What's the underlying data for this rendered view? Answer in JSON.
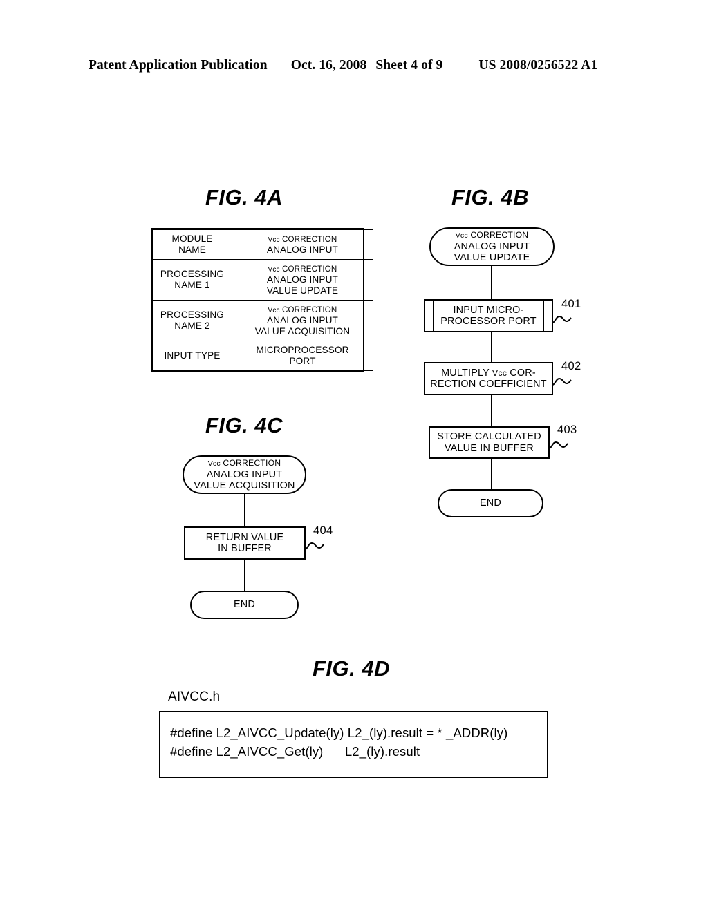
{
  "header": {
    "publication": "Patent Application Publication",
    "date": "Oct. 16, 2008",
    "sheet": "Sheet 4 of 9",
    "patent_number": "US 2008/0256522 A1"
  },
  "figures": {
    "fig4a": {
      "title": "FIG. 4A",
      "type": "table",
      "rows": [
        {
          "label": "MODULE\nNAME",
          "value_line1": "Vcc CORRECTION",
          "value_line2": "ANALOG INPUT",
          "value_line3": ""
        },
        {
          "label": "PROCESSING\nNAME 1",
          "value_line1": "Vcc CORRECTION",
          "value_line2": "ANALOG INPUT",
          "value_line3": "VALUE UPDATE"
        },
        {
          "label": "PROCESSING\nNAME 2",
          "value_line1": "Vcc CORRECTION",
          "value_line2": "ANALOG INPUT",
          "value_line3": "VALUE ACQUISITION"
        },
        {
          "label": "INPUT TYPE",
          "value_line1": "MICROPROCESSOR",
          "value_line2": "PORT",
          "value_line3": ""
        }
      ]
    },
    "fig4b": {
      "title": "FIG. 4B",
      "start": {
        "line1": "Vcc CORRECTION",
        "line2": "ANALOG INPUT",
        "line3": "VALUE UPDATE"
      },
      "steps": [
        {
          "ref": "401",
          "line1": "INPUT MICRO-",
          "line2": "PROCESSOR PORT",
          "shape": "predefined-process"
        },
        {
          "ref": "402",
          "line1": "MULTIPLY Vcc COR-",
          "line2": "RECTION COEFFICIENT",
          "shape": "process"
        },
        {
          "ref": "403",
          "line1": "STORE CALCULATED",
          "line2": "VALUE IN BUFFER",
          "shape": "process"
        }
      ],
      "end": "END"
    },
    "fig4c": {
      "title": "FIG. 4C",
      "start": {
        "line1": "Vcc CORRECTION",
        "line2": "ANALOG INPUT",
        "line3": "VALUE ACQUISITION"
      },
      "steps": [
        {
          "ref": "404",
          "line1": "RETURN VALUE",
          "line2": "IN BUFFER",
          "shape": "process"
        }
      ],
      "end": "END"
    },
    "fig4d": {
      "title": "FIG. 4D",
      "file_label": "AIVCC.h",
      "code_lines": [
        "#define L2_AIVCC_Update(ly) L2_(ly).result = * _ADDR(ly)",
        "#define L2_AIVCC_Get(ly)      L2_(ly).result"
      ]
    }
  }
}
